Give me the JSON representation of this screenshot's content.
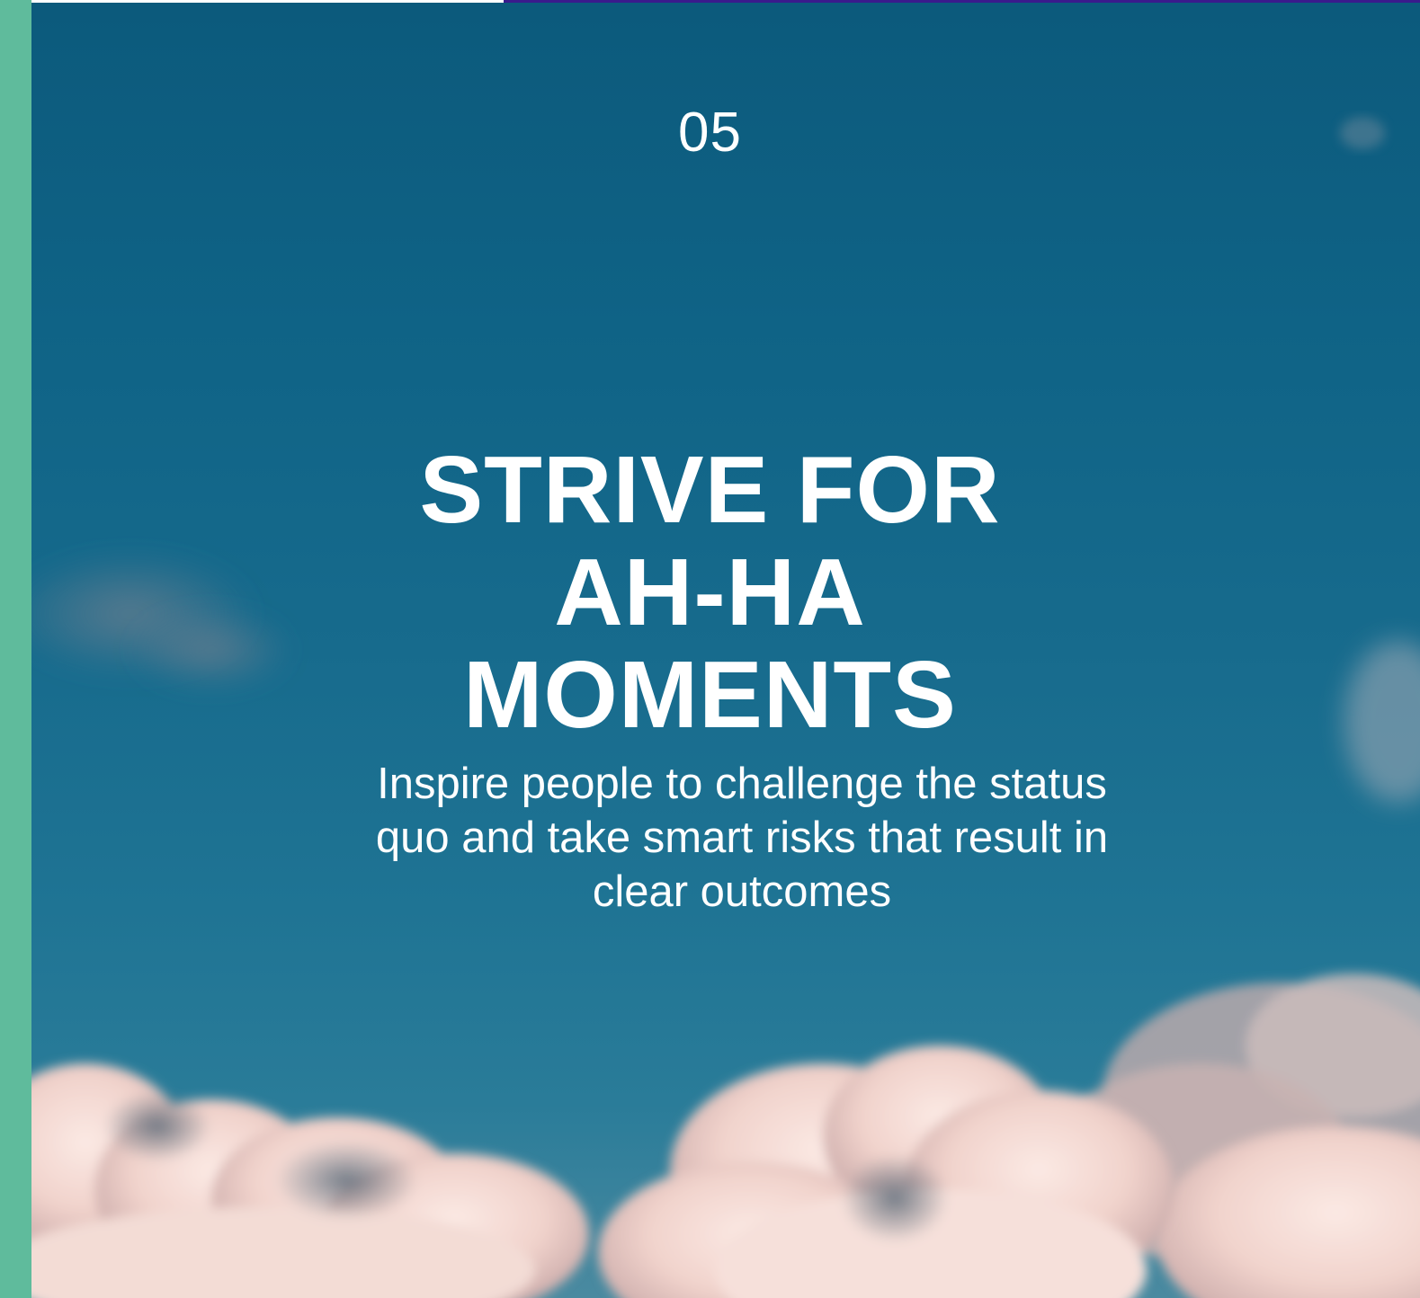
{
  "slide": {
    "number": "05",
    "headline_lines": [
      "STRIVE FOR",
      "AH-HA",
      "MOMENTS"
    ],
    "subtext": "Inspire people to challenge the status quo and take smart risks that result in clear outcomes"
  },
  "progress": {
    "fraction": 0.34
  },
  "background": {
    "description_icon": "sky-with-clouds-image"
  },
  "colors": {
    "rail": "#5fbb9c",
    "progress": "#3a1a8c",
    "sky_top": "#0c5a7c",
    "sky_bottom": "#4a8aa0",
    "text": "#ffffff"
  }
}
